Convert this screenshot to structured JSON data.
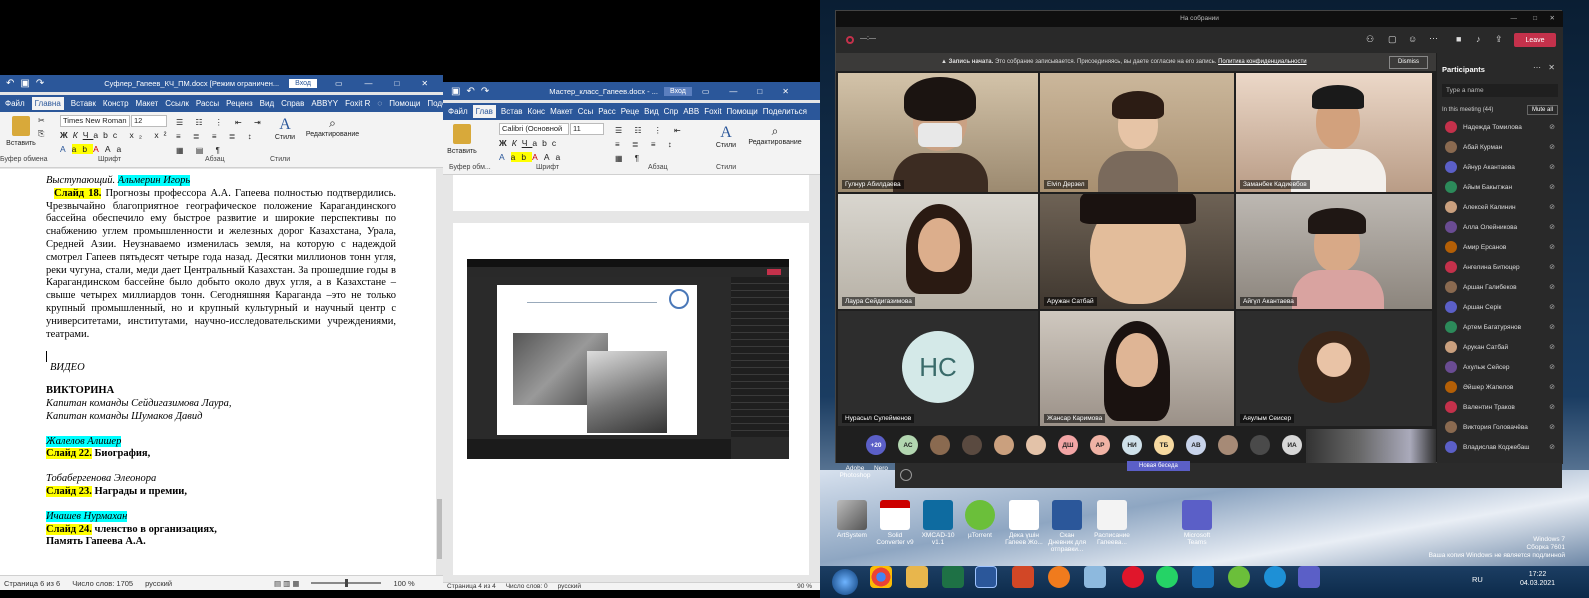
{
  "word1": {
    "title": "Суфлер_Гапеев_КЧ_ПМ.docx [Режим ограничен...",
    "signin": "Вход",
    "menu": [
      "Файл",
      "Главна",
      "Вставк",
      "Констр",
      "Макет",
      "Ссылк",
      "Рассы",
      "Реценз",
      "Вид",
      "Справ",
      "ABBYY",
      "Foxit R"
    ],
    "help": "Помощи",
    "share": "Поделиться",
    "font_name": "Times New Roman",
    "font_size": "12",
    "paste": "Вставить",
    "styles": "Стили",
    "editing": "Редактирование",
    "groups": [
      "Буфер обмена",
      "Шрифт",
      "Абзац",
      "Стили"
    ],
    "doc": {
      "line1_a": "Выступающий. ",
      "line1_b": "Альмерин Игорь",
      "slide18": "Слайд 18.",
      "para": " Прогнозы профессора А.А. Гапеева полностью подтвердились. Чрезвычайно благоприятное географическое положение Карагандинского бассейна обеспечило ему быстрое развитие и широкие перспективы по снабжению углем промышленности и железных дорог Казахстана, Урала, Средней Азии. Неузнаваемо изменилась земля, на которую с надеждой смотрел Гапеев пятьдесят четыре года назад. Десятки миллионов тонн угля, реки чугуна, стали, меди дает Центральный Казахстан. За прошедшие годы в Карагандинском бассейне было добыто около двух угля, а в Казахстане – свыше четырех миллиардов тонн. Сегодняшняя Караганда –это не только крупный промышленный, но и крупный культурный и научный центр с университетами, институтами, научно-исследовательскими учреждениями, театрами.",
      "video": "ВИДЕО",
      "quiz": "ВИКТОРИНА",
      "cap1": "Капитан команды Сейдигазимова Лаура,",
      "cap2": "Капитан команды Шумаков Давид",
      "p1": "Жалелов Алишер",
      "s22": "Слайд 22.",
      "s22t": "  Биография,",
      "p2": "Тобабергенова Элеонора",
      "s23": "Слайд 23.",
      "s23t": " Награды и премии,",
      "p3": "Ичашев Нурмахан",
      "s24": "Слайд 24.",
      "s24t": " членство в организациях,",
      "s24t2": "Память Гапеева А.А."
    },
    "status": {
      "page": "Страница 6 из 6",
      "words": "Число слов: 1705",
      "lang": "русский",
      "zoom": "100 %"
    }
  },
  "word2": {
    "title": "Мастер_класс_Гапеев.docx - ...",
    "signin": "Вход",
    "menu": [
      "Файл",
      "Глав",
      "Встав",
      "Конс",
      "Макет",
      "Ссы",
      "Расс",
      "Реце",
      "Вид",
      "Спр",
      "ABB",
      "Foxit"
    ],
    "help": "Помощи",
    "share": "Поделиться",
    "font_name": "Calibri (Основной",
    "font_size": "11",
    "paste": "Вставить",
    "styles": "Стили",
    "editing": "Редактирование",
    "groups": [
      "Буфер обм...",
      "Шрифт",
      "Абзац",
      "Стили"
    ],
    "status": {
      "page": "Страница 4 из 4",
      "words": "Число слов: 0",
      "lang": "русский",
      "zoom": "90 %"
    }
  },
  "teams": {
    "window_title": "На собрании",
    "leave": "Leave",
    "recording_bold": "Запись начата.",
    "recording_text": " Это собрание записывается. Присоединяясь, вы даете согласие на его запись.",
    "privacy": "Политика конфиденциальности",
    "dismiss": "Dismiss",
    "participants_title": "Participants",
    "search_placeholder": "Type a name",
    "in_meeting": "In this meeting (44)",
    "mute_all": "Mute all",
    "participants": [
      "Надежда Томилова",
      "Абай Курман",
      "Айнур Акантаева",
      "Айым Бакытжан",
      "Алексей Калинин",
      "Алла Олейникова",
      "Амир Ерсанов",
      "Ангелина Битюцер",
      "Аршан Галибеков",
      "Аршан Серік",
      "Артем Багатурянов",
      "Арукан Сатбай",
      "Ахульж Сейсер",
      "Әйшер Жапелов",
      "Валентин Траков",
      "Виктория Головачёва",
      "Владислав Коджебаш"
    ],
    "tiles": [
      "Гулнур Абилдаева",
      "Elvin Дерзел",
      "Заманбек Кадиевбов",
      "Лаура Сейдигазимова",
      "Аружан Сатбай",
      "Айгүл Акантаева",
      "Нурасыл Сулейменов",
      "Жансар Каримова",
      "Аяулым Сеисер"
    ],
    "initials": "НС",
    "chips": [
      "+20",
      "АС",
      "",
      "",
      "",
      "",
      "ДШ",
      "АР",
      "НИ",
      "ТБ",
      "АВ",
      "",
      "",
      "ИА"
    ],
    "new_chat": "Новая беседа"
  },
  "desktop": {
    "icons": [
      "ArtSystem",
      "Solid Converter v9",
      "XMCAD-10 v1.1",
      "µTorrent",
      "Дека үшін Гапеев Жо...",
      "Скан Дневник для отправки...",
      "Расписание Гапеева...",
      "Microsoft Teams"
    ],
    "top_icons": [
      "Adobe Photoshop",
      "Nero"
    ],
    "watermark1": "Windows 7",
    "watermark2": "Сборка 7601",
    "watermark3": "Ваша копия Windows не является подлинной",
    "lang": "RU",
    "time": "17:22",
    "date": "04.03.2021"
  },
  "colors": {
    "word_blue": "#2b579a",
    "teams_bg": "#1f1f1f",
    "leave_red": "#c4314b",
    "taskbar": "#0c2a4a"
  }
}
